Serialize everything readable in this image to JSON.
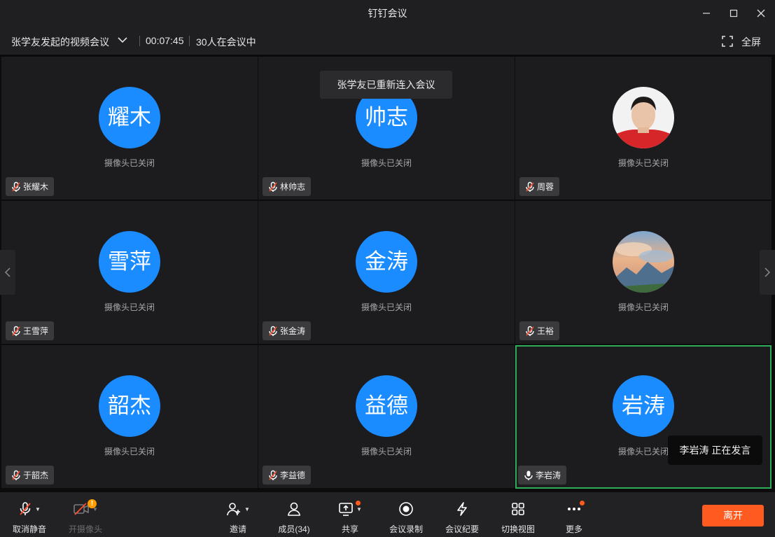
{
  "window": {
    "title": "钉钉会议",
    "controls": {
      "minimize_icon": "minimize-icon",
      "maximize_icon": "maximize-icon",
      "close_icon": "close-icon"
    }
  },
  "meeting": {
    "name": "张学友发起的视频会议",
    "duration": "00:07:45",
    "participants_text": "30人在会议中",
    "fullscreen_label": "全屏"
  },
  "toast": "张学友已重新连入会议",
  "speaking_tip": "李岩涛  正在发言",
  "tiles": [
    {
      "avatar_text": "耀木",
      "status": "摄像头已关闭",
      "name": "张耀木",
      "mic": "muted",
      "avatar": "initials"
    },
    {
      "avatar_text": "帅志",
      "status": "摄像头已关闭",
      "name": "林帅志",
      "mic": "muted",
      "avatar": "initials"
    },
    {
      "avatar_text": "",
      "status": "摄像头已关闭",
      "name": "周蓉",
      "mic": "muted",
      "avatar": "photo-portrait"
    },
    {
      "avatar_text": "雪萍",
      "status": "摄像头已关闭",
      "name": "王雪萍",
      "mic": "muted",
      "avatar": "initials"
    },
    {
      "avatar_text": "金涛",
      "status": "摄像头已关闭",
      "name": "张金涛",
      "mic": "muted",
      "avatar": "initials"
    },
    {
      "avatar_text": "",
      "status": "摄像头已关闭",
      "name": "王裕",
      "mic": "muted",
      "avatar": "photo-landscape"
    },
    {
      "avatar_text": "韶杰",
      "status": "摄像头已关闭",
      "name": "于韶杰",
      "mic": "muted",
      "avatar": "initials"
    },
    {
      "avatar_text": "益德",
      "status": "摄像头已关闭",
      "name": "李益德",
      "mic": "muted",
      "avatar": "initials"
    },
    {
      "avatar_text": "岩涛",
      "status": "摄像头已关闭",
      "name": "李岩涛",
      "mic": "active",
      "avatar": "initials",
      "speaking": true
    }
  ],
  "toolbar": {
    "unmute": "取消静音",
    "camera": "开摄像头",
    "invite": "邀请",
    "members": "成员(34)",
    "share": "共享",
    "record": "会议录制",
    "minutes": "会议纪要",
    "switch_view": "切换视图",
    "more": "更多",
    "leave": "离开",
    "camera_warning": "!"
  },
  "colors": {
    "avatar_blue": "#1a8cff",
    "speaking_border": "#2eae5a",
    "leave_orange": "#ff5a1f",
    "warning": "#ff9d00"
  }
}
